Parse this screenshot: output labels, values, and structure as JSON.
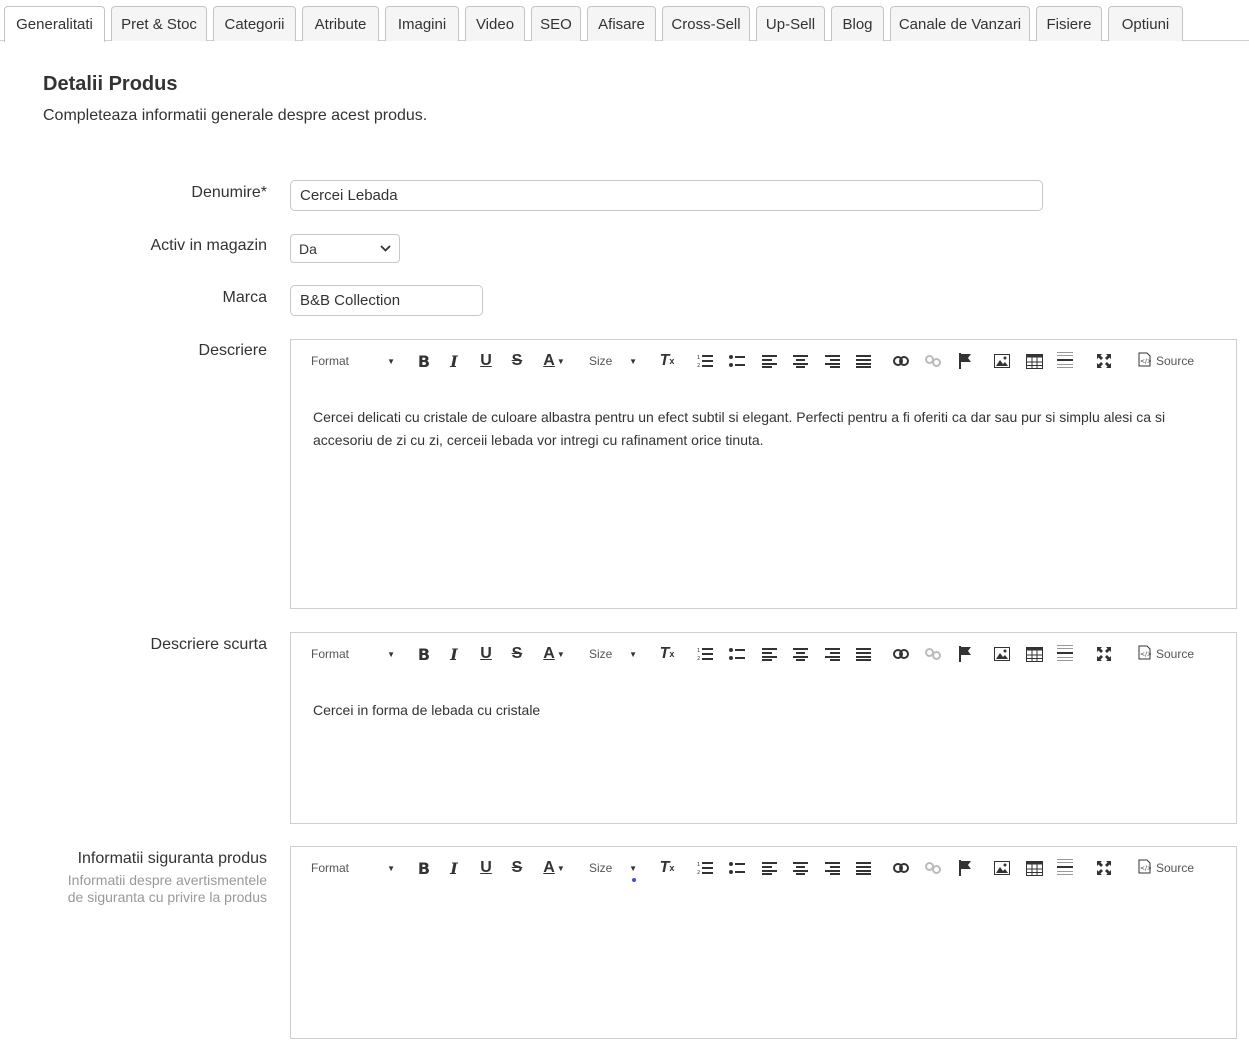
{
  "tabs": [
    {
      "label": "Generalitati",
      "active": true
    },
    {
      "label": "Pret & Stoc",
      "active": false
    },
    {
      "label": "Categorii",
      "active": false
    },
    {
      "label": "Atribute",
      "active": false
    },
    {
      "label": "Imagini",
      "active": false
    },
    {
      "label": "Video",
      "active": false
    },
    {
      "label": "SEO",
      "active": false
    },
    {
      "label": "Afisare",
      "active": false
    },
    {
      "label": "Cross-Sell",
      "active": false
    },
    {
      "label": "Up-Sell",
      "active": false
    },
    {
      "label": "Blog",
      "active": false
    },
    {
      "label": "Canale de Vanzari",
      "active": false
    },
    {
      "label": "Fisiere",
      "active": false
    },
    {
      "label": "Optiuni",
      "active": false
    }
  ],
  "section": {
    "title": "Detalii Produs",
    "subtitle": "Completeaza informatii generale despre acest produs."
  },
  "fields": {
    "name": {
      "label": "Denumire*",
      "value": "Cercei Lebada"
    },
    "active": {
      "label": "Activ in magazin",
      "value": "Da"
    },
    "brand": {
      "label": "Marca",
      "value": "B&B Collection"
    },
    "description": {
      "label": "Descriere",
      "content": "Cercei delicati cu cristale de culoare albastra pentru un efect subtil si elegant. Perfecti pentru a fi oferiti ca dar sau pur si simplu alesi ca si accesoriu de zi cu zi, cerceii lebada vor intregi cu rafinament orice tinuta."
    },
    "short_description": {
      "label": "Descriere scurta",
      "content": "Cercei in forma de lebada cu cristale"
    },
    "safety_info": {
      "label": "Informatii siguranta produs",
      "help": "Informatii despre avertismentele de siguranta cu privire la produs",
      "content": ""
    }
  },
  "toolbar": {
    "format_label": "Format",
    "size_label": "Size",
    "source_label": "Source",
    "buttons": [
      "bold-icon",
      "italic-icon",
      "underline-icon",
      "strikethrough-icon",
      "text-color-icon",
      "remove-format-icon",
      "numbered-list-icon",
      "bulleted-list-icon",
      "align-left-icon",
      "align-center-icon",
      "align-right-icon",
      "justify-icon",
      "link-icon",
      "unlink-icon",
      "anchor-icon",
      "image-icon",
      "table-icon",
      "horizontal-line-icon",
      "maximize-icon",
      "source-icon"
    ]
  }
}
